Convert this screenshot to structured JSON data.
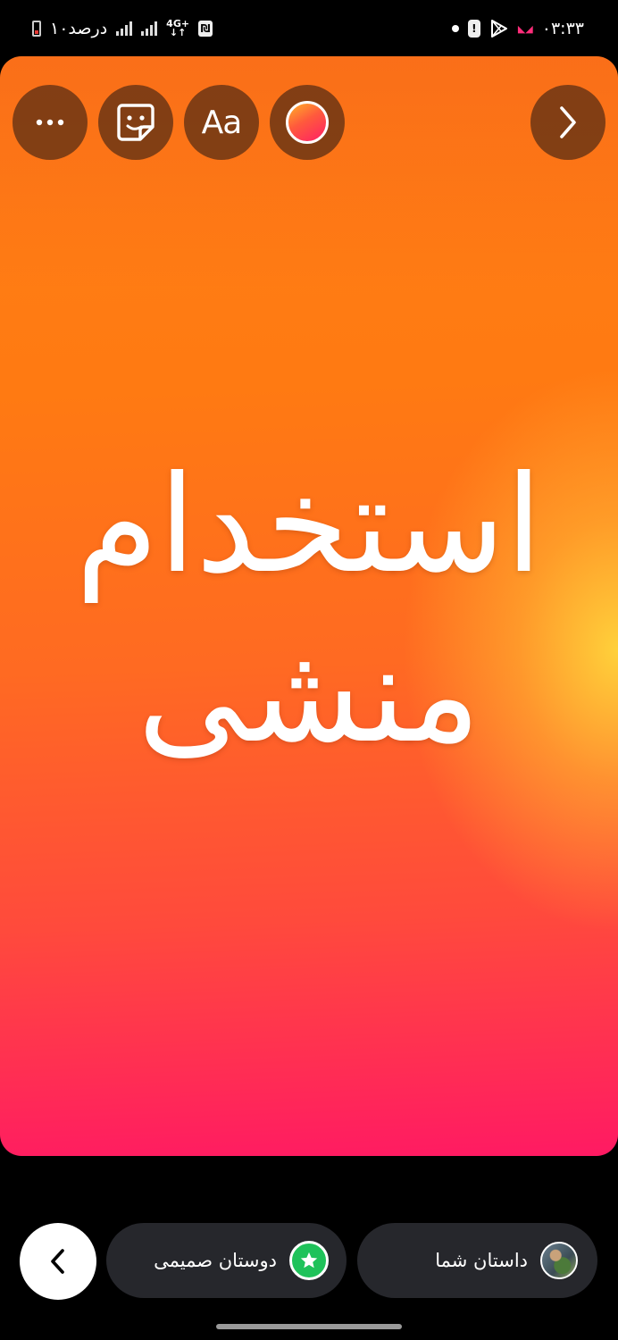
{
  "status_bar": {
    "time": "۰۳:۳۳",
    "battery_text": "۱۰درصد",
    "network": "4G+"
  },
  "toolbar": {
    "more_icon": "more-horizontal-icon",
    "sticker_icon": "sticker-icon",
    "text_label": "Aa",
    "color_icon": "color-picker-icon",
    "next_icon": "chevron-right-icon"
  },
  "story": {
    "text_line1": "استخدام",
    "text_line2": "منشی",
    "colors": {
      "top": "#ff7f16",
      "middle_glow": "#ffd23c",
      "bottom": "#ff1a63"
    }
  },
  "bottom_bar": {
    "back_icon": "chevron-left-icon",
    "close_friends_label": "دوستان صمیمی",
    "your_story_label": "داستان شما",
    "close_friends_color": "#1fc25a"
  }
}
